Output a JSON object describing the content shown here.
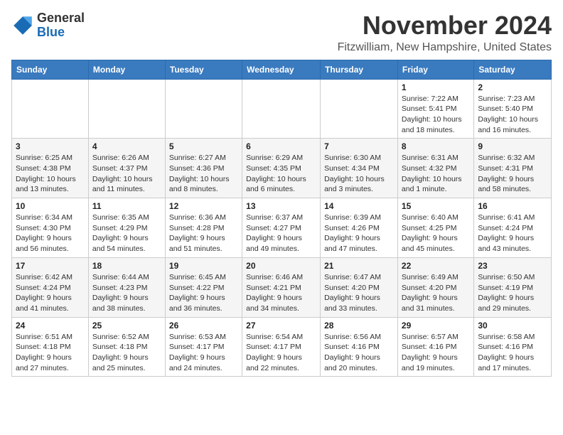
{
  "logo": {
    "general": "General",
    "blue": "Blue"
  },
  "title": "November 2024",
  "location": "Fitzwilliam, New Hampshire, United States",
  "days_header": [
    "Sunday",
    "Monday",
    "Tuesday",
    "Wednesday",
    "Thursday",
    "Friday",
    "Saturday"
  ],
  "weeks": [
    [
      {
        "day": "",
        "info": ""
      },
      {
        "day": "",
        "info": ""
      },
      {
        "day": "",
        "info": ""
      },
      {
        "day": "",
        "info": ""
      },
      {
        "day": "",
        "info": ""
      },
      {
        "day": "1",
        "info": "Sunrise: 7:22 AM\nSunset: 5:41 PM\nDaylight: 10 hours and 18 minutes."
      },
      {
        "day": "2",
        "info": "Sunrise: 7:23 AM\nSunset: 5:40 PM\nDaylight: 10 hours and 16 minutes."
      }
    ],
    [
      {
        "day": "3",
        "info": "Sunrise: 6:25 AM\nSunset: 4:38 PM\nDaylight: 10 hours and 13 minutes."
      },
      {
        "day": "4",
        "info": "Sunrise: 6:26 AM\nSunset: 4:37 PM\nDaylight: 10 hours and 11 minutes."
      },
      {
        "day": "5",
        "info": "Sunrise: 6:27 AM\nSunset: 4:36 PM\nDaylight: 10 hours and 8 minutes."
      },
      {
        "day": "6",
        "info": "Sunrise: 6:29 AM\nSunset: 4:35 PM\nDaylight: 10 hours and 6 minutes."
      },
      {
        "day": "7",
        "info": "Sunrise: 6:30 AM\nSunset: 4:34 PM\nDaylight: 10 hours and 3 minutes."
      },
      {
        "day": "8",
        "info": "Sunrise: 6:31 AM\nSunset: 4:32 PM\nDaylight: 10 hours and 1 minute."
      },
      {
        "day": "9",
        "info": "Sunrise: 6:32 AM\nSunset: 4:31 PM\nDaylight: 9 hours and 58 minutes."
      }
    ],
    [
      {
        "day": "10",
        "info": "Sunrise: 6:34 AM\nSunset: 4:30 PM\nDaylight: 9 hours and 56 minutes."
      },
      {
        "day": "11",
        "info": "Sunrise: 6:35 AM\nSunset: 4:29 PM\nDaylight: 9 hours and 54 minutes."
      },
      {
        "day": "12",
        "info": "Sunrise: 6:36 AM\nSunset: 4:28 PM\nDaylight: 9 hours and 51 minutes."
      },
      {
        "day": "13",
        "info": "Sunrise: 6:37 AM\nSunset: 4:27 PM\nDaylight: 9 hours and 49 minutes."
      },
      {
        "day": "14",
        "info": "Sunrise: 6:39 AM\nSunset: 4:26 PM\nDaylight: 9 hours and 47 minutes."
      },
      {
        "day": "15",
        "info": "Sunrise: 6:40 AM\nSunset: 4:25 PM\nDaylight: 9 hours and 45 minutes."
      },
      {
        "day": "16",
        "info": "Sunrise: 6:41 AM\nSunset: 4:24 PM\nDaylight: 9 hours and 43 minutes."
      }
    ],
    [
      {
        "day": "17",
        "info": "Sunrise: 6:42 AM\nSunset: 4:24 PM\nDaylight: 9 hours and 41 minutes."
      },
      {
        "day": "18",
        "info": "Sunrise: 6:44 AM\nSunset: 4:23 PM\nDaylight: 9 hours and 38 minutes."
      },
      {
        "day": "19",
        "info": "Sunrise: 6:45 AM\nSunset: 4:22 PM\nDaylight: 9 hours and 36 minutes."
      },
      {
        "day": "20",
        "info": "Sunrise: 6:46 AM\nSunset: 4:21 PM\nDaylight: 9 hours and 34 minutes."
      },
      {
        "day": "21",
        "info": "Sunrise: 6:47 AM\nSunset: 4:20 PM\nDaylight: 9 hours and 33 minutes."
      },
      {
        "day": "22",
        "info": "Sunrise: 6:49 AM\nSunset: 4:20 PM\nDaylight: 9 hours and 31 minutes."
      },
      {
        "day": "23",
        "info": "Sunrise: 6:50 AM\nSunset: 4:19 PM\nDaylight: 9 hours and 29 minutes."
      }
    ],
    [
      {
        "day": "24",
        "info": "Sunrise: 6:51 AM\nSunset: 4:18 PM\nDaylight: 9 hours and 27 minutes."
      },
      {
        "day": "25",
        "info": "Sunrise: 6:52 AM\nSunset: 4:18 PM\nDaylight: 9 hours and 25 minutes."
      },
      {
        "day": "26",
        "info": "Sunrise: 6:53 AM\nSunset: 4:17 PM\nDaylight: 9 hours and 24 minutes."
      },
      {
        "day": "27",
        "info": "Sunrise: 6:54 AM\nSunset: 4:17 PM\nDaylight: 9 hours and 22 minutes."
      },
      {
        "day": "28",
        "info": "Sunrise: 6:56 AM\nSunset: 4:16 PM\nDaylight: 9 hours and 20 minutes."
      },
      {
        "day": "29",
        "info": "Sunrise: 6:57 AM\nSunset: 4:16 PM\nDaylight: 9 hours and 19 minutes."
      },
      {
        "day": "30",
        "info": "Sunrise: 6:58 AM\nSunset: 4:16 PM\nDaylight: 9 hours and 17 minutes."
      }
    ]
  ]
}
